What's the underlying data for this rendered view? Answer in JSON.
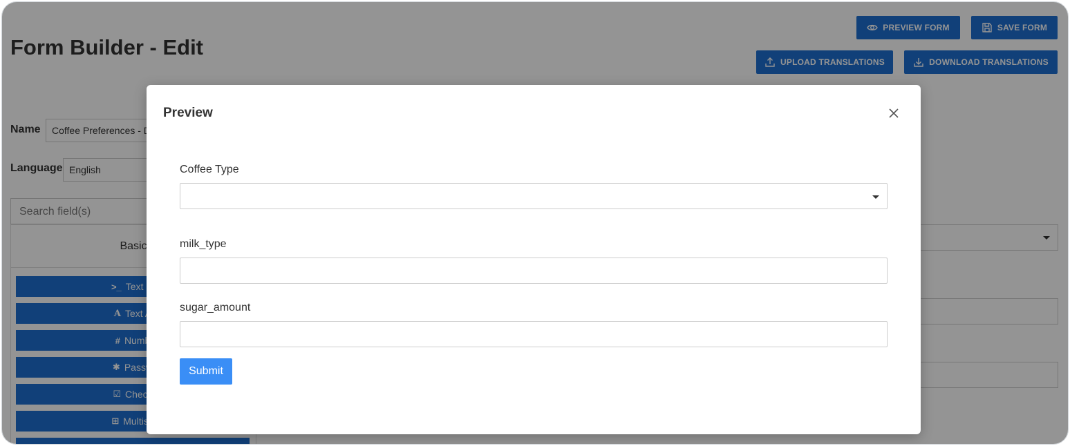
{
  "page": {
    "title": "Form Builder - Edit"
  },
  "header_buttons": {
    "preview_form": "PREVIEW FORM",
    "save_form": "SAVE FORM",
    "upload_translations": "UPLOAD TRANSLATIONS",
    "download_translations": "DOWNLOAD TRANSLATIONS"
  },
  "form_settings": {
    "name_label": "Name",
    "name_value": "Coffee Preferences - D",
    "language_label": "Language",
    "language_value": "English"
  },
  "field_palette": {
    "search_placeholder": "Search field(s)",
    "tab_label": "Basic",
    "items": [
      {
        "icon": "terminal-icon",
        "glyph": ">_",
        "label": "Text Fi"
      },
      {
        "icon": "text-area-icon",
        "glyph": "A",
        "label": "Text A"
      },
      {
        "icon": "hash-icon",
        "glyph": "#",
        "label": "Numb"
      },
      {
        "icon": "asterisk-icon",
        "glyph": "✱",
        "label": "Passw"
      },
      {
        "icon": "checkbox-icon",
        "glyph": "☑",
        "label": "Check"
      },
      {
        "icon": "plus-square-icon",
        "glyph": "⊞",
        "label": "Multise"
      }
    ]
  },
  "modal": {
    "title": "Preview",
    "fields": [
      {
        "label": "Coffee Type",
        "type": "select",
        "value": ""
      },
      {
        "label": "milk_type",
        "type": "text",
        "value": ""
      },
      {
        "label": "sugar_amount",
        "type": "text",
        "value": ""
      }
    ],
    "submit_label": "Submit"
  },
  "colors": {
    "primary": "#1e6fd0",
    "submit": "#3a8ef6",
    "overlay": "rgba(0,0,0,0.42)"
  }
}
